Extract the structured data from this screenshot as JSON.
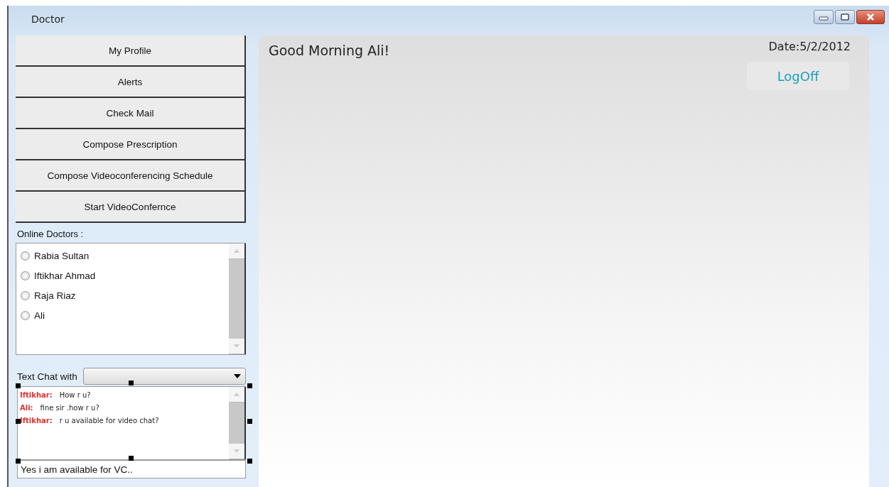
{
  "window": {
    "title": "Doctor"
  },
  "menu_buttons": [
    "My Profile",
    "Alerts",
    "Check Mail",
    "Compose  Prescription",
    "Compose Videoconferencing Schedule",
    "Start VideoConfernce"
  ],
  "online_doctors": {
    "label": "Online Doctors :",
    "items": [
      {
        "name": "Rabia Sultan",
        "selected": false
      },
      {
        "name": "Iftikhar Ahmad",
        "selected": false
      },
      {
        "name": "Raja Riaz",
        "selected": false
      },
      {
        "name": "Ali",
        "selected": false
      }
    ]
  },
  "text_chat": {
    "label": "Text Chat with",
    "messages": [
      {
        "sender": "Iftikhar:",
        "text": "How r u?"
      },
      {
        "sender": "Ali:",
        "text": "fine sir .how r u?"
      },
      {
        "sender": "Iftikhar:",
        "text": "r u available for video chat?"
      }
    ],
    "input": {
      "value": "Yes i am available for VC.."
    }
  },
  "main": {
    "greeting": "Good Morning Ali!",
    "date": "Date:5/2/2012",
    "logoff": "LogOff"
  }
}
